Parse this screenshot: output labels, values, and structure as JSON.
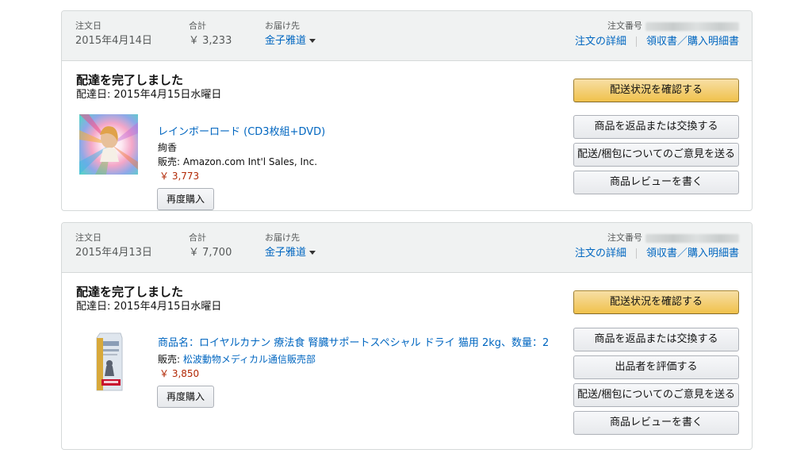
{
  "orders": [
    {
      "date_label": "注文日",
      "date": "2015年4月14日",
      "total_label": "合計",
      "total": "￥ 3,233",
      "ship_label": "お届け先",
      "ship_to": "金子雅道",
      "order_number_label": "注文番号",
      "details_link": "注文の詳細",
      "receipt_link": "領収書／購入明細書",
      "status": "配達を完了しました",
      "delivery_date": "配達日: 2015年4月15日水曜日",
      "product_title": "レインボーロード (CD3枚組+DVD)",
      "artist": "絢香",
      "seller": "販売: Amazon.com Int'l Sales, Inc.",
      "price": "￥ 3,773",
      "rebuy": "再度購入",
      "buttons": [
        "配送状況を確認する",
        "商品を返品または交換する",
        "配送/梱包についてのご意見を送る",
        "商品レビューを書く"
      ]
    },
    {
      "date_label": "注文日",
      "date": "2015年4月13日",
      "total_label": "合計",
      "total": "￥ 7,700",
      "ship_label": "お届け先",
      "ship_to": "金子雅道",
      "order_number_label": "注文番号",
      "details_link": "注文の詳細",
      "receipt_link": "領収書／購入明細書",
      "status": "配達を完了しました",
      "delivery_date": "配達日: 2015年4月15日水曜日",
      "product_title": "商品名：ロイヤルカナン 療法食 腎臓サポートスペシャル ドライ 猫用 2kg、数量：2",
      "seller_prefix": "販売: ",
      "seller_name": "松波動物メディカル通信販売部",
      "price": "￥ 3,850",
      "rebuy": "再度購入",
      "buttons": [
        "配送状況を確認する",
        "商品を返品または交換する",
        "出品者を評価する",
        "配送/梱包についてのご意見を送る",
        "商品レビューを書く"
      ]
    }
  ],
  "colors": {
    "link": "#0066c0",
    "price": "#b12704",
    "primary_button": "#f0c14b",
    "header_bg": "#f0f2f2"
  }
}
